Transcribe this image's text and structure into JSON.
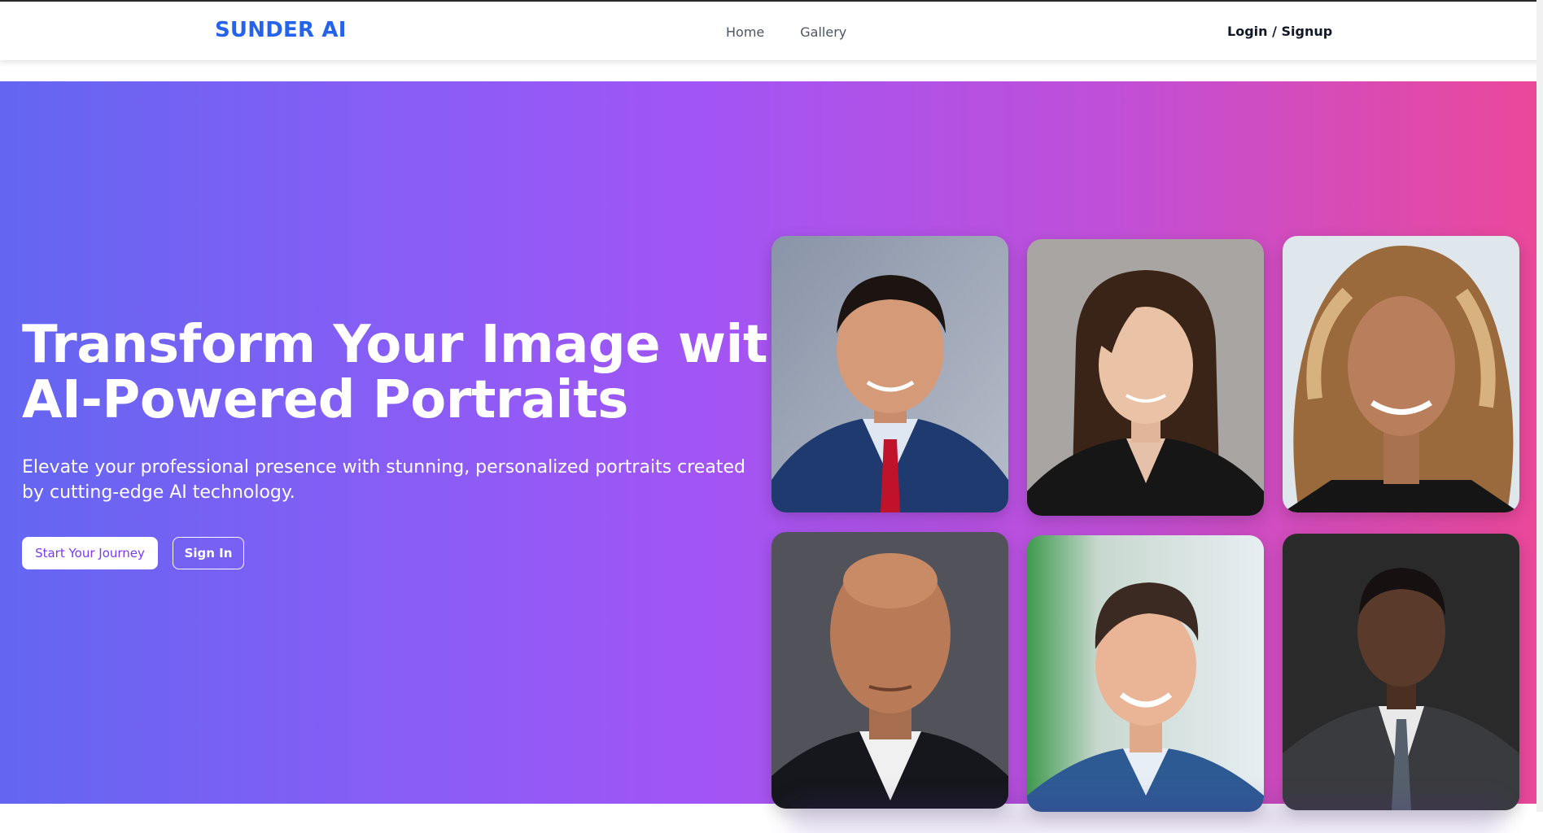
{
  "brand": "SUNDER AI",
  "nav": {
    "items": [
      {
        "label": "Home"
      },
      {
        "label": "Gallery"
      }
    ],
    "login_label": "Login / Signup"
  },
  "hero": {
    "headline_line1": "Transform Your Image with",
    "headline_line2": "AI-Powered Portraits",
    "subtitle": "Elevate your professional presence with stunning, personalized portraits created by cutting-edge AI technology.",
    "primary_button": "Start Your Journey",
    "secondary_button": "Sign In"
  },
  "colors": {
    "brand": "#2563eb",
    "gradient_start": "#6366f1",
    "gradient_mid": "#a155f5",
    "gradient_end": "#ec4899"
  },
  "gallery": {
    "portraits": [
      {
        "subject": "man-suit-red-tie"
      },
      {
        "subject": "woman-dark-blazer"
      },
      {
        "subject": "woman-wavy-hair"
      },
      {
        "subject": "bald-man-suit"
      },
      {
        "subject": "young-man-blue-suit"
      },
      {
        "subject": "man-grey-suit"
      }
    ]
  }
}
